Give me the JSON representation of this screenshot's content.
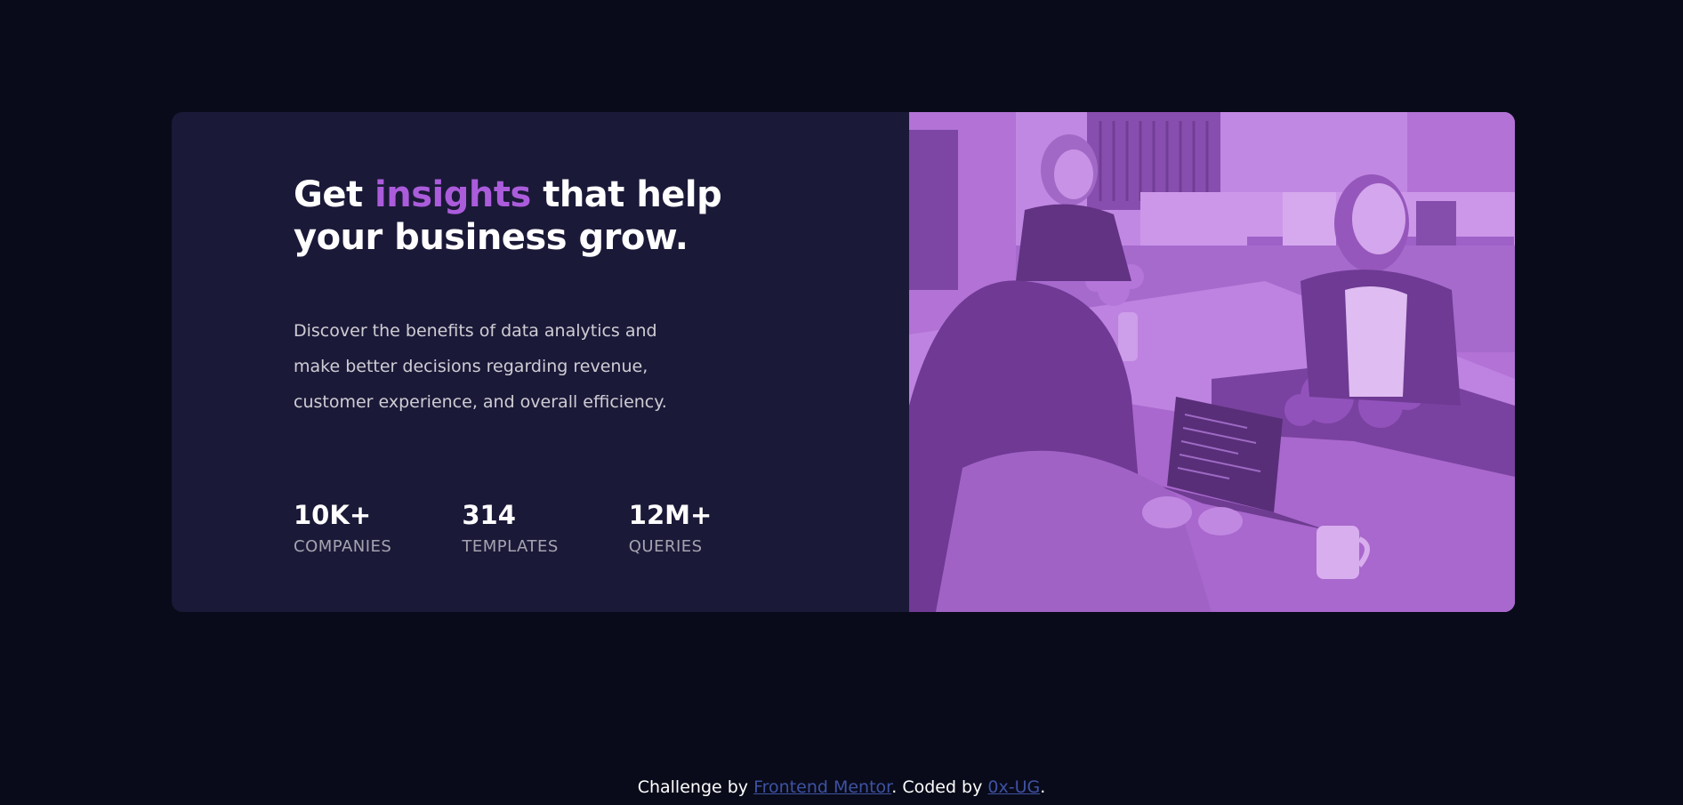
{
  "hero": {
    "title_prefix": "Get ",
    "title_accent": "insights",
    "title_suffix": " that help your business grow.",
    "description": "Discover the benefits of data analytics and make better decisions regarding revenue, customer experience, and overall efficiency."
  },
  "stats": [
    {
      "value": "10K+",
      "label": "COMPANIES"
    },
    {
      "value": "314",
      "label": "TEMPLATES"
    },
    {
      "value": "12M+",
      "label": "QUERIES"
    }
  ],
  "footer": {
    "prefix": "Challenge by ",
    "link1": "Frontend Mentor",
    "middle": ". Coded by ",
    "link2": "0x-UG",
    "suffix": "."
  },
  "colors": {
    "page_bg": "#090b1a",
    "card_bg": "#1b1938",
    "accent": "#ab5cdb",
    "link": "#3e52a3"
  }
}
